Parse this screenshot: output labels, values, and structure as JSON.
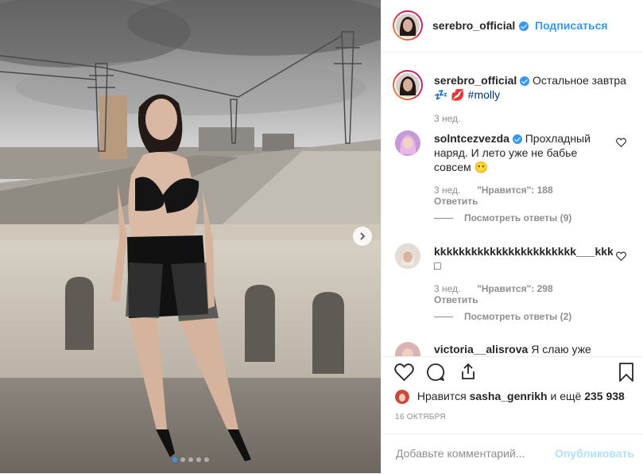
{
  "post": {
    "author": "serebro_official",
    "follow_label": "Подписаться",
    "caption_text": "Остальное завтра",
    "caption_emoji": "💤 💋",
    "caption_hashtag": "#molly",
    "caption_time": "3 нед.",
    "carousel_dots": 5,
    "active_dot": 0
  },
  "comments": [
    {
      "username": "solntcezvezda",
      "verified": true,
      "text": "Прохладный наряд. И лето уже не бабье совсем",
      "emoji": "😶",
      "time": "3 нед.",
      "likes_label": "\"Нравится\": 188",
      "reply_label": "Ответить",
      "view_replies": "Посмотреть ответы (9)"
    },
    {
      "username": "kkkkkkkkkkkkkkkkkkkkkkk___kkkk",
      "verified": true,
      "text": "□",
      "time": "3 нед.",
      "likes_label": "\"Нравится\": 298",
      "reply_label": "Ответить",
      "view_replies": "Посмотреть ответы (2)"
    },
    {
      "username": "victoria__alisrova",
      "text": "Я слаю уже"
    }
  ],
  "likes": {
    "prefix": "Нравится",
    "user": "sasha_genrikh",
    "middle": "и ещё",
    "count": "235 938"
  },
  "date": "16 ОКТЯБРЯ",
  "add_comment": {
    "placeholder": "Добавьте комментарий...",
    "publish_label": "Опубликовать"
  },
  "icons": [
    "heart-icon",
    "comment-icon",
    "share-icon",
    "bookmark-icon",
    "chevron-right-icon"
  ],
  "colors": {
    "accent": "#3897f0",
    "text": "#262626",
    "muted": "#8e8e8e",
    "publish_disabled": "#b2dffc",
    "hashtag": "#003569"
  }
}
